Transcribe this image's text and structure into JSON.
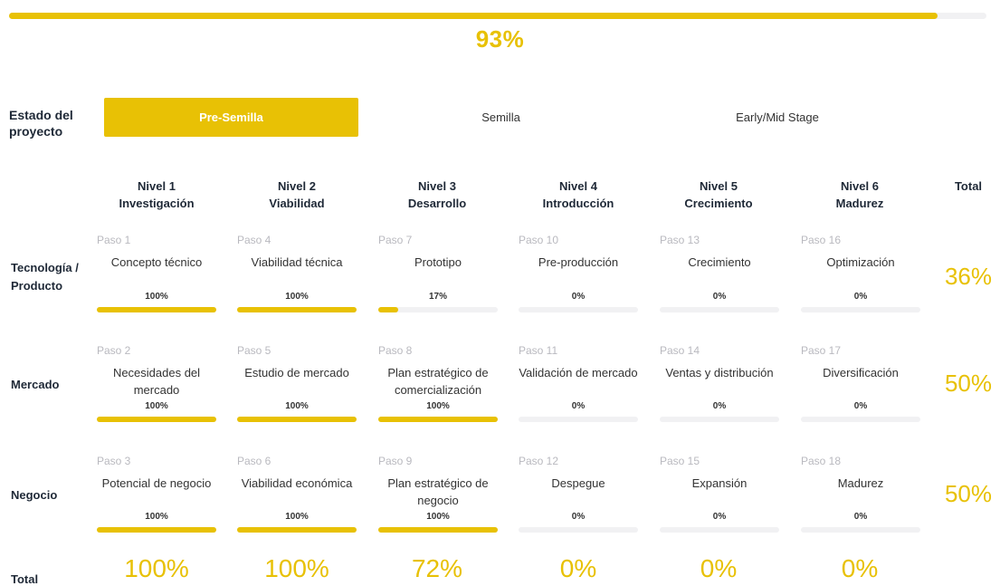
{
  "colors": {
    "accent": "#E8C105",
    "track": "#F1F1F3",
    "muted": "#B9B9BF"
  },
  "overall": {
    "label": "93%",
    "progress": 0.95
  },
  "estado": {
    "label": "Estado del proyecto",
    "tabs": [
      {
        "label": "Pre-Semilla",
        "active": true
      },
      {
        "label": "Semilla",
        "active": false
      },
      {
        "label": "Early/Mid Stage",
        "active": false
      }
    ]
  },
  "levels": [
    {
      "name": "Nivel 1",
      "subtitle": "Investigación"
    },
    {
      "name": "Nivel 2",
      "subtitle": "Viabilidad"
    },
    {
      "name": "Nivel 3",
      "subtitle": "Desarrollo"
    },
    {
      "name": "Nivel 4",
      "subtitle": "Introducción"
    },
    {
      "name": "Nivel 5",
      "subtitle": "Crecimiento"
    },
    {
      "name": "Nivel 6",
      "subtitle": "Madurez"
    }
  ],
  "total_label": "Total",
  "rows": [
    {
      "label": "Tecnología / Producto",
      "total": "36%",
      "cells": [
        {
          "step": "Paso 1",
          "title": "Concepto técnico",
          "pct": "100%",
          "progress": 1.0
        },
        {
          "step": "Paso 4",
          "title": "Viabilidad técnica",
          "pct": "100%",
          "progress": 1.0
        },
        {
          "step": "Paso 7",
          "title": "Prototipo",
          "pct": "17%",
          "progress": 0.17
        },
        {
          "step": "Paso 10",
          "title": "Pre-producción",
          "pct": "0%",
          "progress": 0
        },
        {
          "step": "Paso 13",
          "title": "Crecimiento",
          "pct": "0%",
          "progress": 0
        },
        {
          "step": "Paso 16",
          "title": "Optimización",
          "pct": "0%",
          "progress": 0
        }
      ]
    },
    {
      "label": "Mercado",
      "total": "50%",
      "cells": [
        {
          "step": "Paso 2",
          "title": "Necesidades del mercado",
          "pct": "100%",
          "progress": 1.0
        },
        {
          "step": "Paso 5",
          "title": "Estudio de mercado",
          "pct": "100%",
          "progress": 1.0
        },
        {
          "step": "Paso 8",
          "title": "Plan estratégico de comercialización",
          "pct": "100%",
          "progress": 1.0
        },
        {
          "step": "Paso 11",
          "title": "Validación de mercado",
          "pct": "0%",
          "progress": 0
        },
        {
          "step": "Paso 14",
          "title": "Ventas y distribución",
          "pct": "0%",
          "progress": 0
        },
        {
          "step": "Paso 17",
          "title": "Diversificación",
          "pct": "0%",
          "progress": 0
        }
      ]
    },
    {
      "label": "Negocio",
      "total": "50%",
      "cells": [
        {
          "step": "Paso 3",
          "title": "Potencial de negocio",
          "pct": "100%",
          "progress": 1.0
        },
        {
          "step": "Paso 6",
          "title": "Viabilidad económica",
          "pct": "100%",
          "progress": 1.0
        },
        {
          "step": "Paso 9",
          "title": "Plan estratégico de negocio",
          "pct": "100%",
          "progress": 1.0
        },
        {
          "step": "Paso 12",
          "title": "Despegue",
          "pct": "0%",
          "progress": 0
        },
        {
          "step": "Paso 15",
          "title": "Expansión",
          "pct": "0%",
          "progress": 0
        },
        {
          "step": "Paso 18",
          "title": "Madurez",
          "pct": "0%",
          "progress": 0
        }
      ]
    }
  ],
  "column_totals": [
    "100%",
    "100%",
    "72%",
    "0%",
    "0%",
    "0%"
  ]
}
